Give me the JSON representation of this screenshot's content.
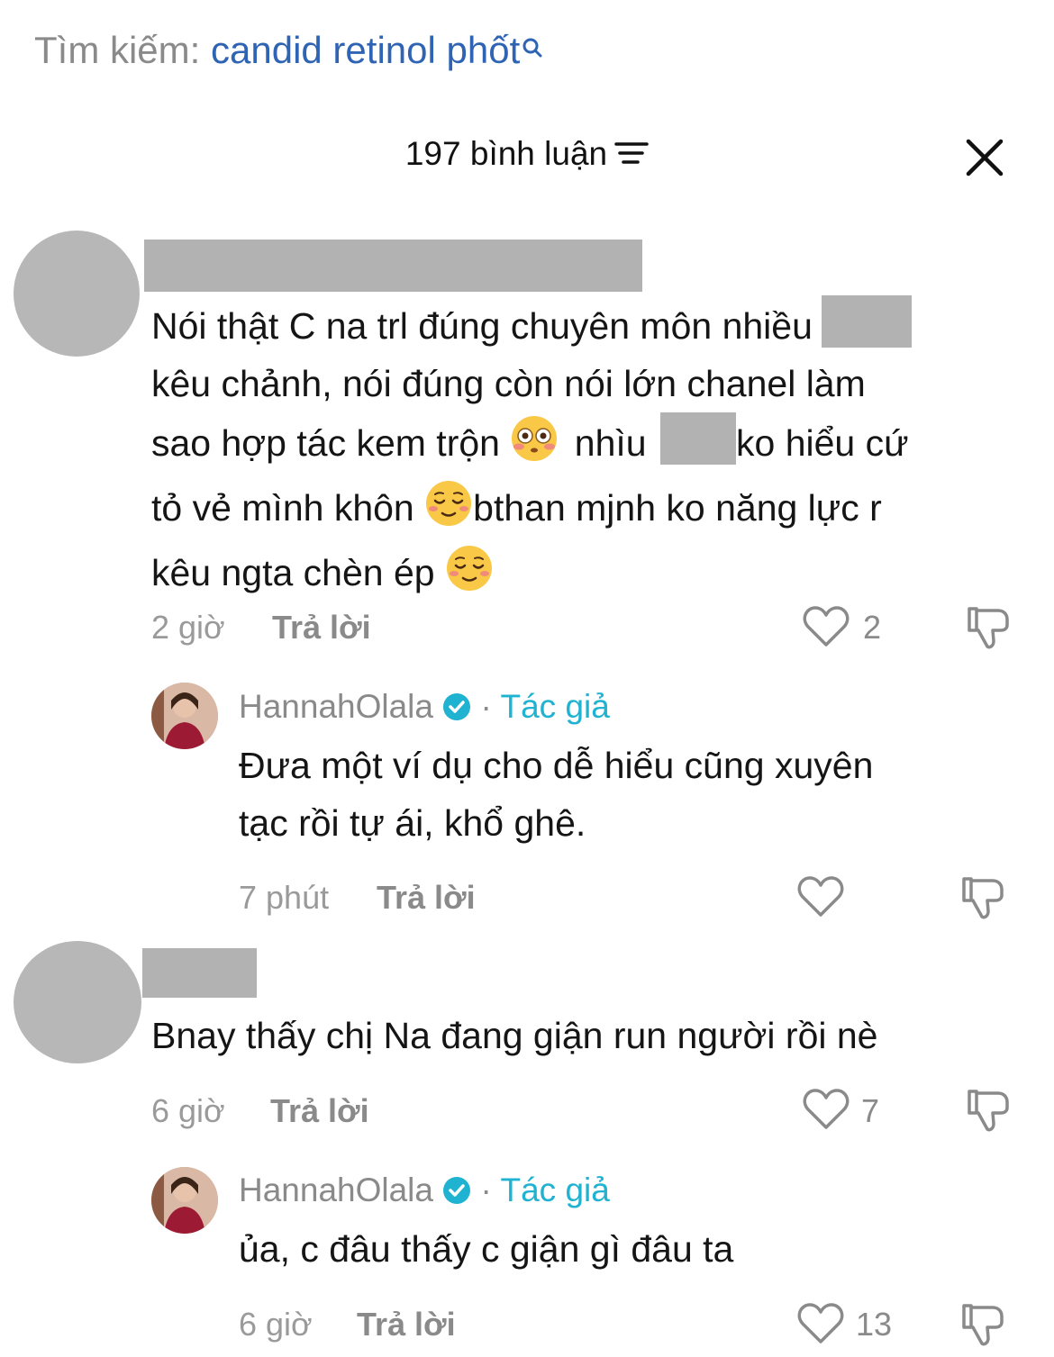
{
  "search": {
    "label": "Tìm kiếm:",
    "query": "candid retinol phốt"
  },
  "header": {
    "comment_count": "197 bình luận"
  },
  "comments": [
    {
      "text_lines": [
        "Nói thật C na trl đúng chuyên môn nhiều",
        "kêu chảnh, nói đúng còn nói lớn chanel làm",
        "sao hợp tác kem trộn",
        "nhìu",
        "ko hiểu cứ",
        "tỏ vẻ mình khôn",
        "bthan mjnh ko năng lực r",
        "kêu ngta chèn ép"
      ],
      "time": "2 giờ",
      "reply_label": "Trả lời",
      "likes": "2",
      "reply": {
        "username": "HannahOlala",
        "author_label": "Tác giả",
        "separator": "·",
        "text_lines": [
          "Đưa một ví dụ cho dễ hiểu cũng xuyên",
          "tạc rồi tự ái, khổ ghê."
        ],
        "time": "7 phút",
        "reply_label": "Trả lời"
      }
    },
    {
      "text_lines": [
        "Bnay thấy chị Na đang giận run người rồi nè"
      ],
      "time": "6 giờ",
      "reply_label": "Trả lời",
      "likes": "7",
      "reply": {
        "username": "HannahOlala",
        "author_label": "Tác giả",
        "separator": "·",
        "text_lines": [
          "ủa, c đâu thấy c giận gì đâu ta"
        ],
        "time": "6 giờ",
        "reply_label": "Trả lời",
        "likes": "13"
      }
    }
  ],
  "colors": {
    "accent": "#2e64b3",
    "author": "#20b3d1",
    "verified": "#20b3d1",
    "redaction": "#b2b2b2"
  },
  "icons": [
    "search-icon",
    "filter-icon",
    "close-icon",
    "heart-icon",
    "dislike-icon",
    "verified-icon",
    "flushed-emoji",
    "relieved-emoji"
  ]
}
